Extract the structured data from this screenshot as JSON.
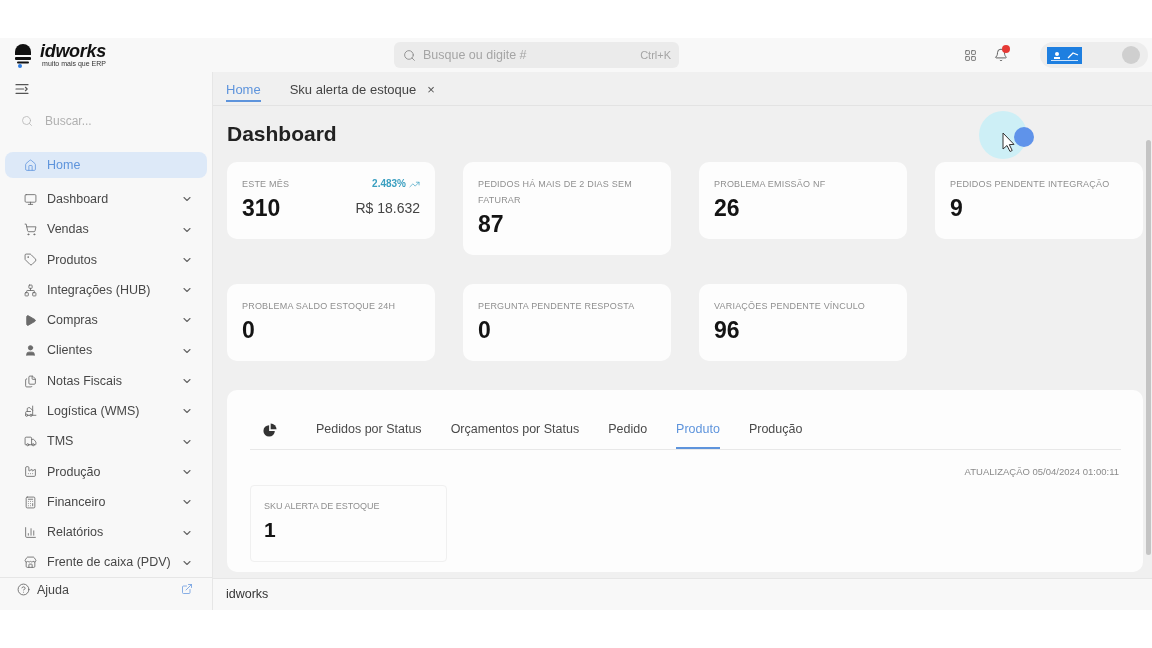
{
  "header": {
    "logo": {
      "name": "idworks",
      "tagline": "muito mais que ERP"
    },
    "search": {
      "placeholder": "Busque ou digite #",
      "shortcut": "Ctrl+K"
    },
    "notifications": {
      "unread": true
    }
  },
  "sidebar": {
    "search": {
      "placeholder": "Buscar..."
    },
    "items": [
      {
        "label": "Home",
        "selected": true,
        "expandable": false
      },
      {
        "label": "Dashboard",
        "selected": false,
        "expandable": true
      },
      {
        "label": "Vendas",
        "selected": false,
        "expandable": true
      },
      {
        "label": "Produtos",
        "selected": false,
        "expandable": true
      },
      {
        "label": "Integrações (HUB)",
        "selected": false,
        "expandable": true
      },
      {
        "label": "Compras",
        "selected": false,
        "expandable": true
      },
      {
        "label": "Clientes",
        "selected": false,
        "expandable": true
      },
      {
        "label": "Notas Fiscais",
        "selected": false,
        "expandable": true
      },
      {
        "label": "Logística (WMS)",
        "selected": false,
        "expandable": true
      },
      {
        "label": "TMS",
        "selected": false,
        "expandable": true
      },
      {
        "label": "Produção",
        "selected": false,
        "expandable": true
      },
      {
        "label": "Financeiro",
        "selected": false,
        "expandable": true
      },
      {
        "label": "Relatórios",
        "selected": false,
        "expandable": true
      },
      {
        "label": "Frente de caixa (PDV)",
        "selected": false,
        "expandable": true
      }
    ],
    "help": {
      "label": "Ajuda"
    }
  },
  "tabs": [
    {
      "label": "Home",
      "selected": true
    },
    {
      "label": "Sku alerta de estoque",
      "selected": false,
      "close": "×"
    }
  ],
  "page": {
    "title": "Dashboard"
  },
  "cards": [
    {
      "label": "ESTE MÊS",
      "value": "310",
      "change": "2.483%",
      "amount": "R$ 18.632"
    },
    {
      "label": "PEDIDOS HÁ MAIS DE 2 DIAS SEM FATURAR",
      "value": "87"
    },
    {
      "label": "PROBLEMA EMISSÃO NF",
      "value": "26"
    },
    {
      "label": "PEDIDOS PENDENTE INTEGRAÇÃO",
      "value": "9"
    },
    {
      "label": "PROBLEMA SALDO ESTOQUE 24H",
      "value": "0"
    },
    {
      "label": "PERGUNTA PENDENTE RESPOSTA",
      "value": "0"
    },
    {
      "label": "VARIAÇÕES PENDENTE VÍNCULO",
      "value": "96"
    }
  ],
  "panel": {
    "tabs": [
      {
        "label": "Pedidos por Status",
        "selected": false
      },
      {
        "label": "Orçamentos por Status",
        "selected": false
      },
      {
        "label": "Pedido",
        "selected": false
      },
      {
        "label": "Produto",
        "selected": true
      },
      {
        "label": "Produção",
        "selected": false
      }
    ],
    "updated": "ATUALIZAÇÃO 05/04/2024 01:00:11",
    "cards": [
      {
        "label": "SKU ALERTA DE ESTOQUE",
        "value": "1"
      }
    ]
  },
  "footer": {
    "text": "idworks"
  }
}
